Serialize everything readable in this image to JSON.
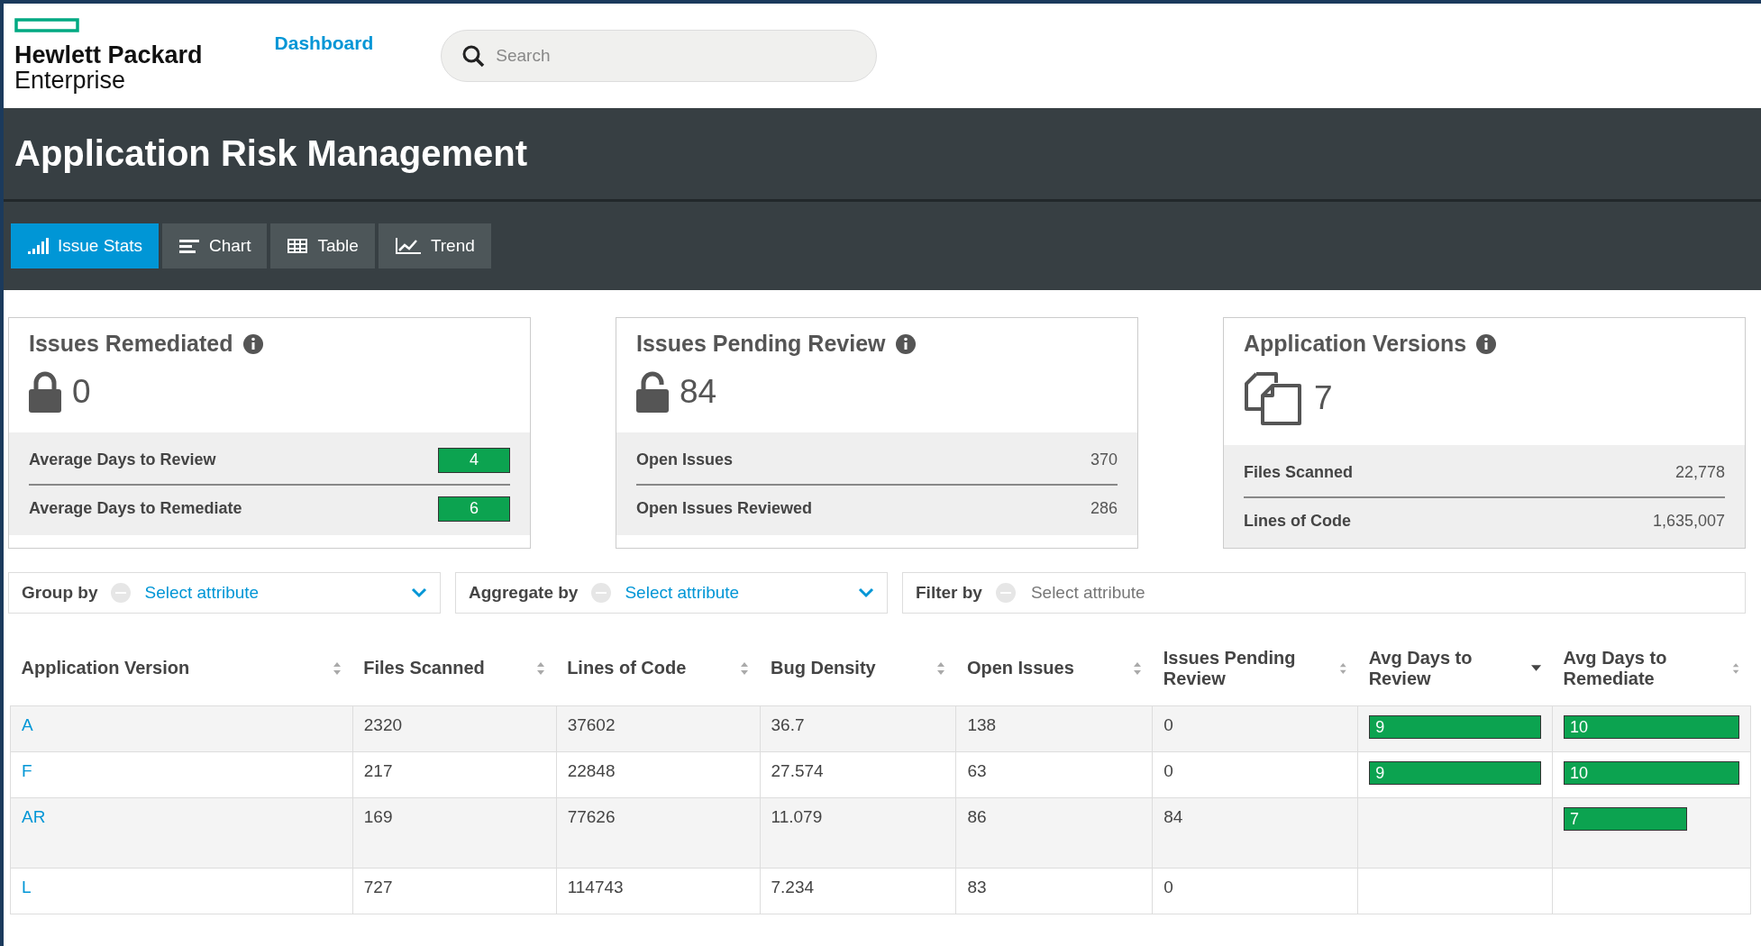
{
  "header": {
    "logo_line_1": "Hewlett Packard",
    "logo_line_2": "Enterprise",
    "nav_link": "Dashboard",
    "search": {
      "placeholder": "Search"
    }
  },
  "title": "Application Risk Management",
  "tabs": [
    {
      "label": "Issue Stats",
      "selected": true
    },
    {
      "label": "Chart",
      "selected": false
    },
    {
      "label": "Table",
      "selected": false
    },
    {
      "label": "Trend",
      "selected": false
    }
  ],
  "cards": [
    {
      "title": "Issues Remediated",
      "value": "0",
      "rows": [
        {
          "label": "Average Days to Review",
          "value": "4",
          "kind": "badge"
        },
        {
          "label": "Average Days to Remediate",
          "value": "6",
          "kind": "badge"
        }
      ]
    },
    {
      "title": "Issues Pending Review",
      "value": "84",
      "rows": [
        {
          "label": "Open Issues",
          "value": "370",
          "kind": "text"
        },
        {
          "label": "Open Issues Reviewed",
          "value": "286",
          "kind": "text"
        }
      ]
    },
    {
      "title": "Application Versions",
      "value": "7",
      "rows": [
        {
          "label": "Files Scanned",
          "value": "22,778",
          "kind": "text"
        },
        {
          "label": "Lines of Code",
          "value": "1,635,007",
          "kind": "text"
        }
      ]
    }
  ],
  "filters": [
    {
      "label": "Group by",
      "placeholder": "Select attribute",
      "kind": "dropdown"
    },
    {
      "label": "Aggregate by",
      "placeholder": "Select attribute",
      "kind": "dropdown"
    },
    {
      "label": "Filter by",
      "placeholder": "Select attribute",
      "kind": "search"
    }
  ],
  "table": {
    "columns": [
      "Application Version",
      "Files Scanned",
      "Lines of Code",
      "Bug Density",
      "Open Issues",
      "Issues Pending Review",
      "Avg Days to Review",
      "Avg Days to Remediate"
    ],
    "rows": [
      {
        "version": "A",
        "files": "2320",
        "loc": "37602",
        "density": "36.7",
        "open": "138",
        "pending": "0",
        "review": "9",
        "remediate": "10"
      },
      {
        "version": "F",
        "files": "217",
        "loc": "22848",
        "density": "27.574",
        "open": "63",
        "pending": "0",
        "review": "9",
        "remediate": "10"
      },
      {
        "version": "AR",
        "files": "169",
        "loc": "77626",
        "density": "11.079",
        "open": "86",
        "pending": "84",
        "remediate": "7"
      },
      {
        "version": "L",
        "files": "727",
        "loc": "114743",
        "density": "7.234",
        "open": "83",
        "pending": "0"
      }
    ]
  }
}
